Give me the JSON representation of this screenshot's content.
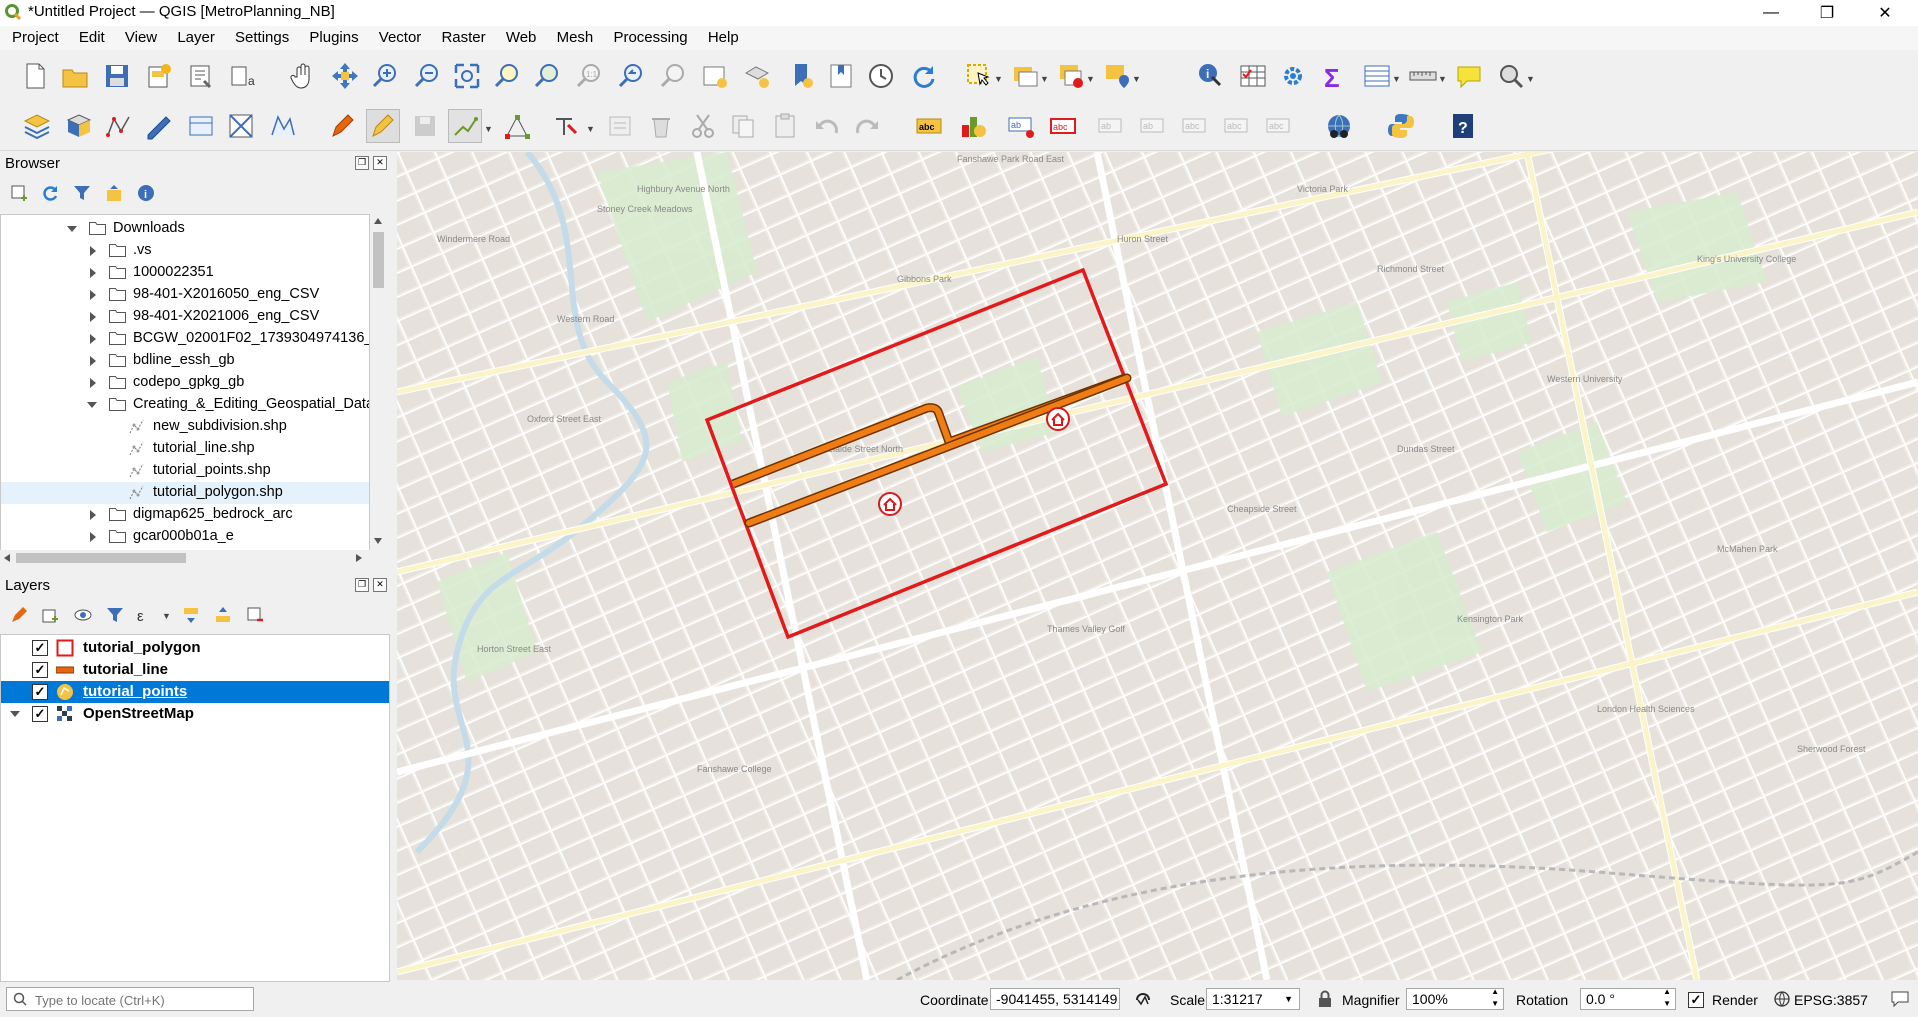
{
  "window": {
    "title": "*Untitled Project — QGIS [MetroPlanning_NB]",
    "minimize": "—",
    "maximize": "❐",
    "close": "✕"
  },
  "menu": [
    "Project",
    "Edit",
    "View",
    "Layer",
    "Settings",
    "Plugins",
    "Vector",
    "Raster",
    "Web",
    "Mesh",
    "Processing",
    "Help"
  ],
  "browser": {
    "title": "Browser",
    "items": [
      {
        "label": "Downloads",
        "type": "folder",
        "expanded": true
      },
      {
        "label": ".vs",
        "type": "folder"
      },
      {
        "label": "1000022351",
        "type": "folder"
      },
      {
        "label": "98-401-X2016050_eng_CSV",
        "type": "folder"
      },
      {
        "label": "98-401-X2021006_eng_CSV",
        "type": "folder"
      },
      {
        "label": "BCGW_02001F02_1739304974136_2",
        "type": "folder"
      },
      {
        "label": "bdline_essh_gb",
        "type": "folder"
      },
      {
        "label": "codepo_gpkg_gb",
        "type": "folder"
      },
      {
        "label": "Creating_&_Editing_Geospatial_Data",
        "type": "folder",
        "expanded": true
      },
      {
        "label": "new_subdivision.shp",
        "type": "shp"
      },
      {
        "label": "tutorial_line.shp",
        "type": "shp"
      },
      {
        "label": "tutorial_points.shp",
        "type": "shp"
      },
      {
        "label": "tutorial_polygon.shp",
        "type": "shp",
        "hover": true
      },
      {
        "label": "digmap625_bedrock_arc",
        "type": "folder"
      },
      {
        "label": "gcar000b01a_e",
        "type": "folder"
      }
    ]
  },
  "layers": {
    "title": "Layers",
    "items": [
      {
        "label": "tutorial_polygon",
        "checked": true,
        "symbol": "polygon",
        "color": "#e31a1c"
      },
      {
        "label": "tutorial_line",
        "checked": true,
        "symbol": "line",
        "color": "#e8650f"
      },
      {
        "label": "tutorial_points",
        "checked": true,
        "symbol": "point",
        "selected": true
      },
      {
        "label": "OpenStreetMap",
        "checked": true,
        "symbol": "raster"
      }
    ]
  },
  "map": {
    "polygon_color": "#e31a1c",
    "line_color": "#f07d14",
    "point_color": "#d7191c",
    "basemap_labels": [
      "Stoney Creek Meadows",
      "Windermere Road",
      "Fanshawe Park Road East",
      "Western Road",
      "Huron Street",
      "Richmond Street",
      "Adelaide Street North",
      "Oxford Street East",
      "Dundas Street",
      "Horton Street East",
      "Highbury Avenue North",
      "King's University College",
      "Gibbons Park",
      "Victoria Park",
      "Kensington Park",
      "Fanshawe College",
      "Thames Valley Golf",
      "Western University",
      "Cheapside Street",
      "London Health Sciences",
      "McMahen Park",
      "Sherwood Forest"
    ]
  },
  "status": {
    "locate_placeholder": "Type to locate (Ctrl+K)",
    "coordinate_label": "Coordinate",
    "coordinate_value": "-9041455, 5314149",
    "scale_label": "Scale",
    "scale_value": "1:31217",
    "magnifier_label": "Magnifier",
    "magnifier_value": "100%",
    "rotation_label": "Rotation",
    "rotation_value": "0.0 °",
    "render_label": "Render",
    "render_checked": true,
    "crs": "EPSG:3857"
  }
}
